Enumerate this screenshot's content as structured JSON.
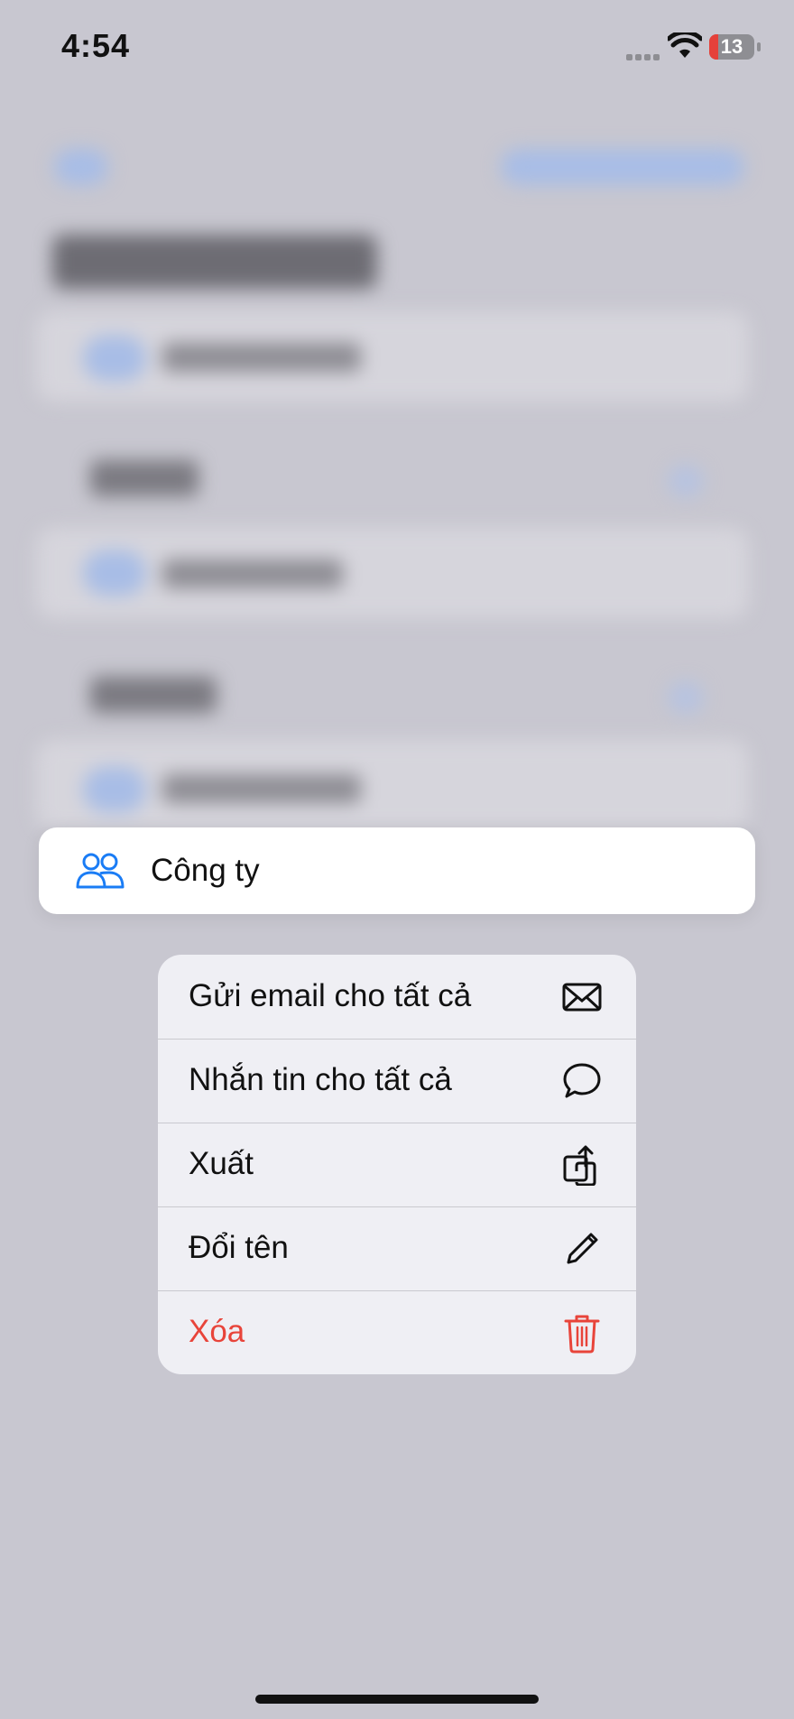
{
  "status_bar": {
    "time": "4:54",
    "battery": "13"
  },
  "group": {
    "name": "Công ty",
    "icon": "person-2-icon"
  },
  "menu": {
    "items": [
      {
        "label": "Gửi email cho tất cả",
        "icon": "envelope-icon",
        "color": "#111111"
      },
      {
        "label": "Nhắn tin cho tất cả",
        "icon": "message-bubble-icon",
        "color": "#111111"
      },
      {
        "label": "Xuất",
        "icon": "share-export-icon",
        "color": "#111111"
      },
      {
        "label": "Đổi tên",
        "icon": "pencil-icon",
        "color": "#111111"
      },
      {
        "label": "Xóa",
        "icon": "trash-icon",
        "color": "#e8443a"
      }
    ]
  },
  "colors": {
    "accent": "#1a7cf5",
    "destructive": "#e8443a",
    "backdrop": "#c8c7d0"
  }
}
